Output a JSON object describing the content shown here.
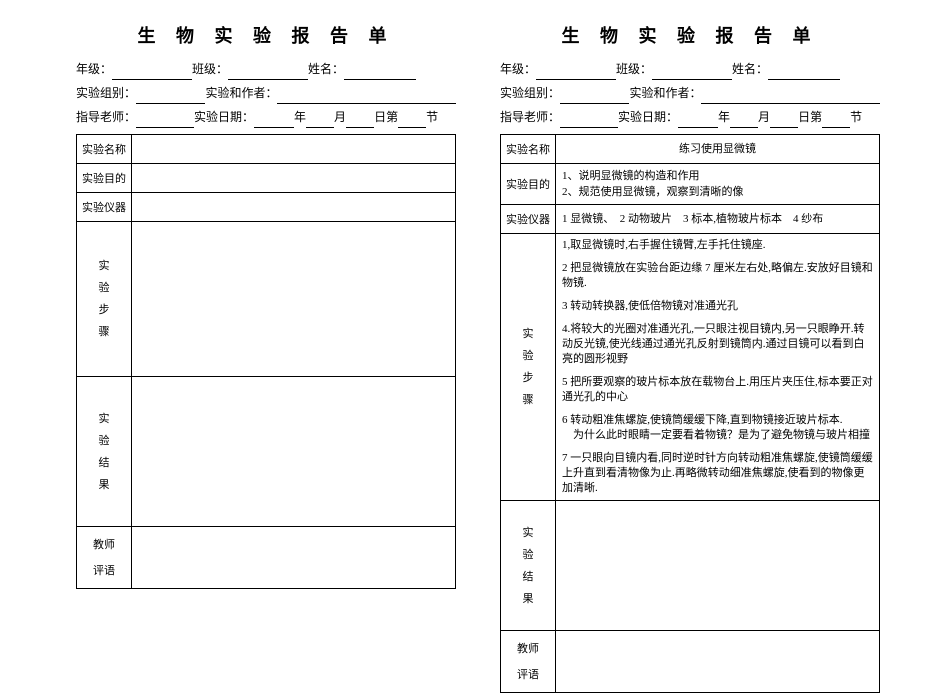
{
  "title": "生 物 实 验 报 告 单",
  "header": {
    "grade": "年级：",
    "class_": "班级：",
    "name": "姓名：",
    "group": "实验组别：",
    "author": "实验和作者：",
    "teacher": "指导老师：",
    "date_prefix": "实验日期：",
    "year": "年",
    "month": "月",
    "day": "日第",
    "period": "节"
  },
  "labels": {
    "exp_name": "实验名称",
    "purpose": "实验目的",
    "instruments": "实验仪器",
    "steps_v": "实验步骤",
    "results_v": "实验结果",
    "teacher_comment1": "教师",
    "teacher_comment2": "评语"
  },
  "left": {
    "exp_name": "",
    "purpose": "",
    "instruments": "",
    "steps": [
      "",
      "",
      "",
      "",
      "",
      "",
      ""
    ]
  },
  "right": {
    "exp_name": "练习使用显微镜",
    "purpose_1": "1、说明显微镜的构造和作用",
    "purpose_2": "2、规范使用显微镜，观察到清晰的像",
    "instruments": "1 显微镜、　2 动物玻片　3 标本,植物玻片标本　4 纱布",
    "steps": [
      "1,取显微镜时,右手握住镜臂,左手托住镜座.",
      "2 把显微镜放在实验台距边缘 7 厘米左右处,略偏左.安放好目镜和物镜.",
      "3 转动转换器,使低倍物镜对准通光孔",
      "4.将较大的光圈对准通光孔,一只眼注视目镜内,另一只眼睁开.转动反光镜,使光线通过通光孔反射到镜筒内.通过目镜可以看到白亮的圆形视野",
      "5 把所要观察的玻片标本放在载物台上.用压片夹压住,标本要正对通光孔的中心",
      "6 转动粗准焦螺旋,使镜筒缓缓下降,直到物镜接近玻片标本.\n　为什么此时眼睛一定要看着物镜？是为了避免物镜与玻片相撞",
      "7 一只眼向目镜内看,同时逆时针方向转动粗准焦螺旋,使镜筒缓缓上升直到看清物像为止.再略微转动细准焦螺旋,使看到的物像更加清晰."
    ]
  }
}
